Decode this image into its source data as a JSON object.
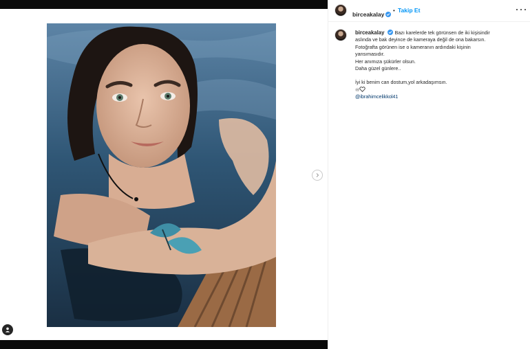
{
  "post": {
    "username": "birceakalay",
    "follow_label": "Takip Et",
    "dot": "•",
    "caption_lines": [
      "Bazı karelerde tek görünsen de iki kişisindir",
      "aslında ve bak deyince de kameraya değil de ona bakarsın.",
      "Fotoğrafta görünen ise o kameranın ardındaki kişinin",
      "yansımasıdır.",
      "Her anımıza şükürler olsun.",
      "Daha güzel günlere.."
    ],
    "caption_line2": "İyi ki benim can dostum,yol arkadaşımsın.",
    "caption_heart_prefix": "♾",
    "mention": "@ibrahimcelikkol41"
  },
  "colors": {
    "accent": "#0095f6",
    "verified": "#3897f0",
    "mention": "#00376b",
    "letterbox": "#0a0a0a"
  },
  "icons": {
    "next": "chevron-right-icon",
    "user_tag": "user-icon",
    "more": "more-horizontal-icon",
    "verified": "verified-badge-icon",
    "heart": "heart-icon"
  }
}
